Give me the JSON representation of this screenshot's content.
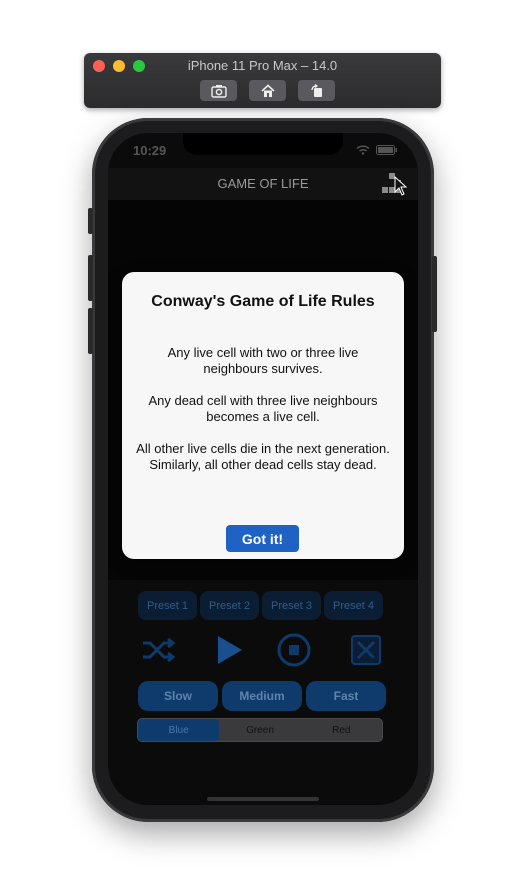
{
  "simulator": {
    "title": "iPhone 11 Pro Max – 14.0",
    "tools": [
      "screenshot-icon",
      "home-icon",
      "rotate-icon"
    ]
  },
  "status_bar": {
    "time": "10:29"
  },
  "nav": {
    "title": "GAME OF LIFE",
    "grid_button_icon": "grid-pattern-icon"
  },
  "presets": [
    "Preset 1",
    "Preset 2",
    "Preset 3",
    "Preset 4"
  ],
  "controls": [
    "shuffle-icon",
    "play-icon",
    "stop-icon",
    "clear-icon"
  ],
  "speeds": [
    "Slow",
    "Medium",
    "Fast"
  ],
  "color_options": {
    "options": [
      "Blue",
      "Green",
      "Red"
    ],
    "selected": "Blue"
  },
  "alert": {
    "title": "Conway's Game of Life Rules",
    "rules": [
      "Any live cell with two or three live neighbours survives.",
      "Any dead cell with three live neighbours becomes a live cell.",
      "All other live cells die in the next generation. Similarly, all other dead cells stay dead."
    ],
    "button": "Got it!"
  },
  "colors": {
    "accent": "#1e63c4",
    "alert_bg": "#f7f7f7",
    "screen_bg": "#0b0b0b"
  }
}
